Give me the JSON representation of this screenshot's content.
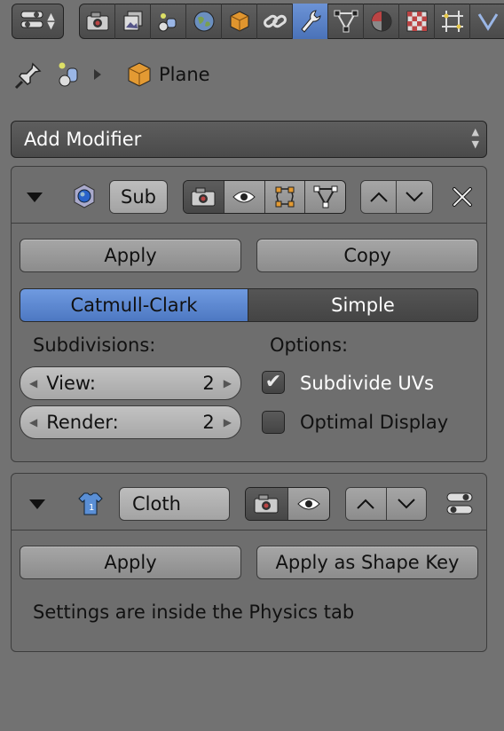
{
  "header": {
    "editor_type_icon": "properties-editor-icon",
    "tabs": [
      {
        "icon": "render-icon"
      },
      {
        "icon": "render-layers-icon"
      },
      {
        "icon": "scene-icon"
      },
      {
        "icon": "world-icon"
      },
      {
        "icon": "object-icon"
      },
      {
        "icon": "constraints-icon"
      },
      {
        "icon": "modifiers-wrench-icon",
        "active": true
      },
      {
        "icon": "object-data-icon"
      },
      {
        "icon": "material-icon"
      },
      {
        "icon": "texture-icon"
      },
      {
        "icon": "particles-icon"
      },
      {
        "icon": "physics-icon"
      }
    ]
  },
  "breadcrumb": {
    "object_name": "Plane"
  },
  "add_modifier": {
    "label": "Add Modifier"
  },
  "subsurf": {
    "name": "Sub",
    "apply_label": "Apply",
    "copy_label": "Copy",
    "mode_catmull": "Catmull-Clark",
    "mode_simple": "Simple",
    "active_mode": "Catmull-Clark",
    "subdivisions_label": "Subdivisions:",
    "view_label": "View:",
    "view_value": "2",
    "render_label": "Render:",
    "render_value": "2",
    "options_label": "Options:",
    "subdivide_uvs_label": "Subdivide UVs",
    "subdivide_uvs_checked": true,
    "optimal_display_label": "Optimal Display",
    "optimal_display_checked": false
  },
  "cloth": {
    "name": "Cloth",
    "apply_label": "Apply",
    "apply_shape_key_label": "Apply as Shape Key",
    "info_text": "Settings are inside the Physics tab"
  },
  "colors": {
    "background": "#727272",
    "accent_blue": "#5a85cf",
    "panel": "#6e6e6e"
  }
}
